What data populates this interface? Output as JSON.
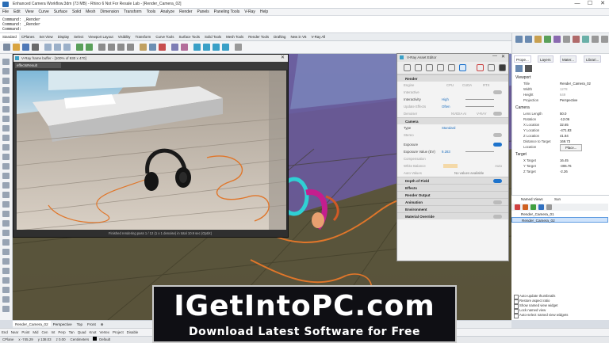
{
  "window": {
    "title": "Enhanced Camera Workflow.3dm (73 MB) - Rhino 6 Not For Resale Lab - [Render_Camera_02]",
    "min": "—",
    "max": "☐",
    "close": "✕"
  },
  "menu": [
    "File",
    "Edit",
    "View",
    "Curve",
    "Surface",
    "Solid",
    "Mesh",
    "Dimension",
    "Transform",
    "Tools",
    "Analyze",
    "Render",
    "Panels",
    "Paneling Tools",
    "V-Ray",
    "Help"
  ],
  "command": {
    "line1": "Command: _Render",
    "line2": "Command: _Render",
    "prompt": "Command:"
  },
  "toolbar_tabs": [
    "Standard",
    "CPlanes",
    "Set View",
    "Display",
    "Select",
    "Viewport Layout",
    "Visibility",
    "Transform",
    "Curve Tools",
    "Surface Tools",
    "Solid Tools",
    "Mesh Tools",
    "Render Tools",
    "Drafting",
    "New in V6",
    "V-Ray All"
  ],
  "vfb": {
    "title": "V-Ray frame buffer - [100% of 930 x 470]",
    "channel": "effectsResult",
    "status": "Finished rendering pass 1 / 12 (1 x 1 denoise) in total 10.9 sec (OptiX)"
  },
  "asset_editor": {
    "title": "V-Ray Asset Editor",
    "sections": {
      "render": "Render",
      "camera": "Camera",
      "dof": "Depth of Field",
      "effects": "Effects",
      "render_output": "Render Output",
      "animation": "Animation",
      "environment": "Environment",
      "material_override": "Material Override"
    },
    "engine": {
      "label": "Engine",
      "cpu": "CPU",
      "cuda": "CUDA",
      "rtx": "RTX"
    },
    "interactive": "Interactive",
    "interactivity": {
      "label": "Interactivity",
      "value": "High"
    },
    "update_effects": {
      "label": "Update Effects",
      "value": "Often"
    },
    "denoiser": {
      "label": "Denoiser",
      "nvidia": "NVIDIA AI",
      "vray": "V-RAY"
    },
    "type": {
      "label": "Type",
      "value": "Standard"
    },
    "stereo": "Stereo",
    "exposure": "Exposure",
    "ev": {
      "label": "Exposure Value (EV)",
      "value": "9.283"
    },
    "compensation": "Compensation",
    "white_balance": {
      "label": "White Balance",
      "value": "Auto"
    },
    "auto_values": {
      "label": "Auto Values",
      "value": "No values available"
    }
  },
  "right_panel": {
    "tabs": [
      "Prope...",
      "Layers",
      "Mater...",
      "Librari..."
    ],
    "viewport_label": "Viewport",
    "viewport": [
      {
        "k": "Title",
        "v": "Render_Camera_02"
      },
      {
        "k": "Width",
        "v": "1278"
      },
      {
        "k": "Height",
        "v": "649"
      },
      {
        "k": "Projection",
        "v": "Perspective"
      }
    ],
    "camera_label": "Camera",
    "camera": [
      {
        "k": "Lens Length",
        "v": "50.0"
      },
      {
        "k": "Rotation",
        "v": "-12.06"
      },
      {
        "k": "X Location",
        "v": "32.65"
      },
      {
        "k": "Y Location",
        "v": "-471.83"
      },
      {
        "k": "Z Location",
        "v": "41.84"
      },
      {
        "k": "Distance to Target",
        "v": "169.73"
      },
      {
        "k": "Location",
        "v": "Place..."
      }
    ],
    "target_label": "Target",
    "target": [
      {
        "k": "X Target",
        "v": "16.45"
      },
      {
        "k": "Y Target",
        "v": "-306.76"
      },
      {
        "k": "Z Target",
        "v": "-2.26"
      }
    ]
  },
  "named_views": {
    "tabs": [
      "Named Views",
      "Sun"
    ],
    "items": [
      "Render_Camera_01",
      "Render_Camera_02"
    ],
    "options": [
      "Auto-update thumbnails",
      "Restore aspect ratio",
      "Show named view widget",
      "Lock named view",
      "Auto-select named view widgets"
    ]
  },
  "view_tabs": [
    "Render_Camera_02",
    "Perspective",
    "Top",
    "Front",
    "⊕"
  ],
  "osnap": [
    "End",
    "Near",
    "Point",
    "Mid",
    "Cen",
    "Int",
    "Perp",
    "Tan",
    "Quad",
    "Knot",
    "Vertex",
    "Project",
    "Disable"
  ],
  "status": {
    "cplane": "CPlane",
    "x": "x -745.29",
    "y": "y 138.03",
    "z": "z 0.00",
    "units": "Centimeters",
    "layer": "Default"
  },
  "watermark": {
    "line1": "IGetIntoPC.com",
    "line2": "Download Latest Software for Free"
  },
  "colors": {
    "accent": "#1e73cc",
    "headphone_cable": "#e0762a",
    "cyan_ring": "#2fd0d4",
    "magenta": "#c41e8e"
  }
}
